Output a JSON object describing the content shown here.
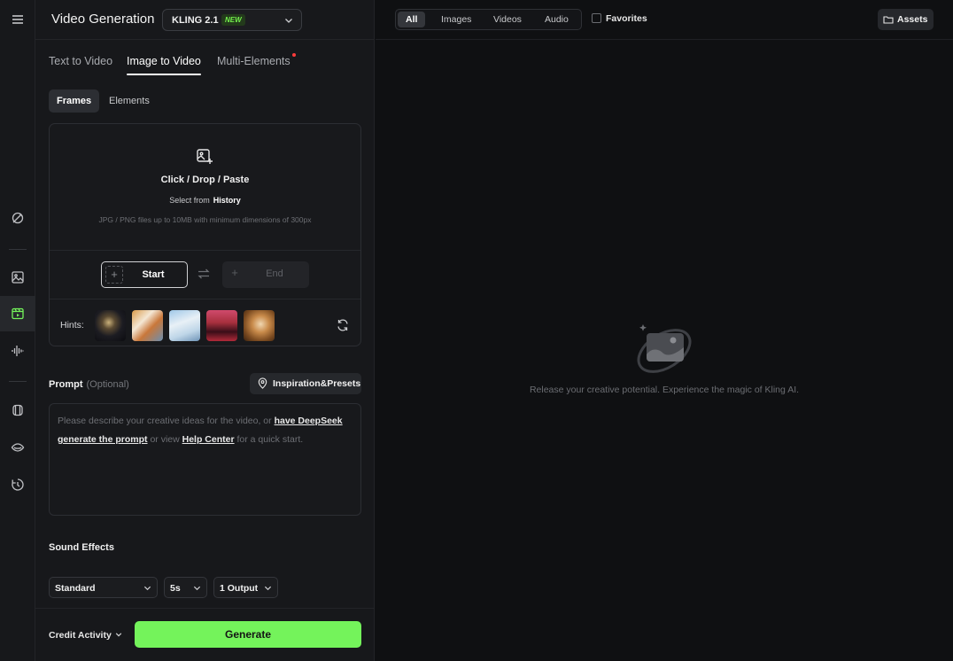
{
  "header": {
    "title": "Video Generation",
    "model": "KLING 2.1",
    "model_badge": "NEW"
  },
  "tabs": [
    {
      "label": "Text to Video"
    },
    {
      "label": "Image to Video"
    },
    {
      "label": "Multi-Elements"
    }
  ],
  "subtabs": [
    {
      "label": "Frames"
    },
    {
      "label": "Elements"
    }
  ],
  "upload": {
    "title": "Click / Drop / Paste",
    "select_prefix": "Select from",
    "select_link": "History",
    "hint": "JPG / PNG files up to 10MB with minimum dimensions of 300px",
    "start_label": "Start",
    "end_label": "End",
    "hints_label": "Hints:"
  },
  "prompt": {
    "label": "Prompt",
    "optional": "(Optional)",
    "presets_label": "Inspiration&Presets",
    "placeholder_part1": "Please describe your creative ideas for the video, or",
    "link1": "have DeepSeek generate the prompt",
    "placeholder_part2": "or view",
    "link2": "Help Center",
    "placeholder_part3": "for a quick start."
  },
  "sound": {
    "label": "Sound Effects"
  },
  "options": {
    "mode": "Standard",
    "duration": "5s",
    "outputs": "1 Output"
  },
  "footer": {
    "credit_label": "Credit Activity",
    "generate_label": "Generate"
  },
  "right": {
    "filters": [
      {
        "label": "All"
      },
      {
        "label": "Images"
      },
      {
        "label": "Videos"
      },
      {
        "label": "Audio"
      }
    ],
    "favorites_label": "Favorites",
    "assets_label": "Assets",
    "empty_text": "Release your creative potential. Experience the magic of Kling AI."
  },
  "colors": {
    "accent": "#74f35b",
    "background": "#0f1012",
    "panel": "#17181b"
  },
  "icons": [
    "menu-icon",
    "magic-brush-icon",
    "image-icon",
    "video-icon",
    "audio-wave-icon",
    "element-cube-icon",
    "eye-icon",
    "history-icon",
    "upload-image-icon",
    "swap-icon",
    "refresh-icon",
    "pin-icon",
    "chevron-down-icon",
    "folder-icon"
  ]
}
